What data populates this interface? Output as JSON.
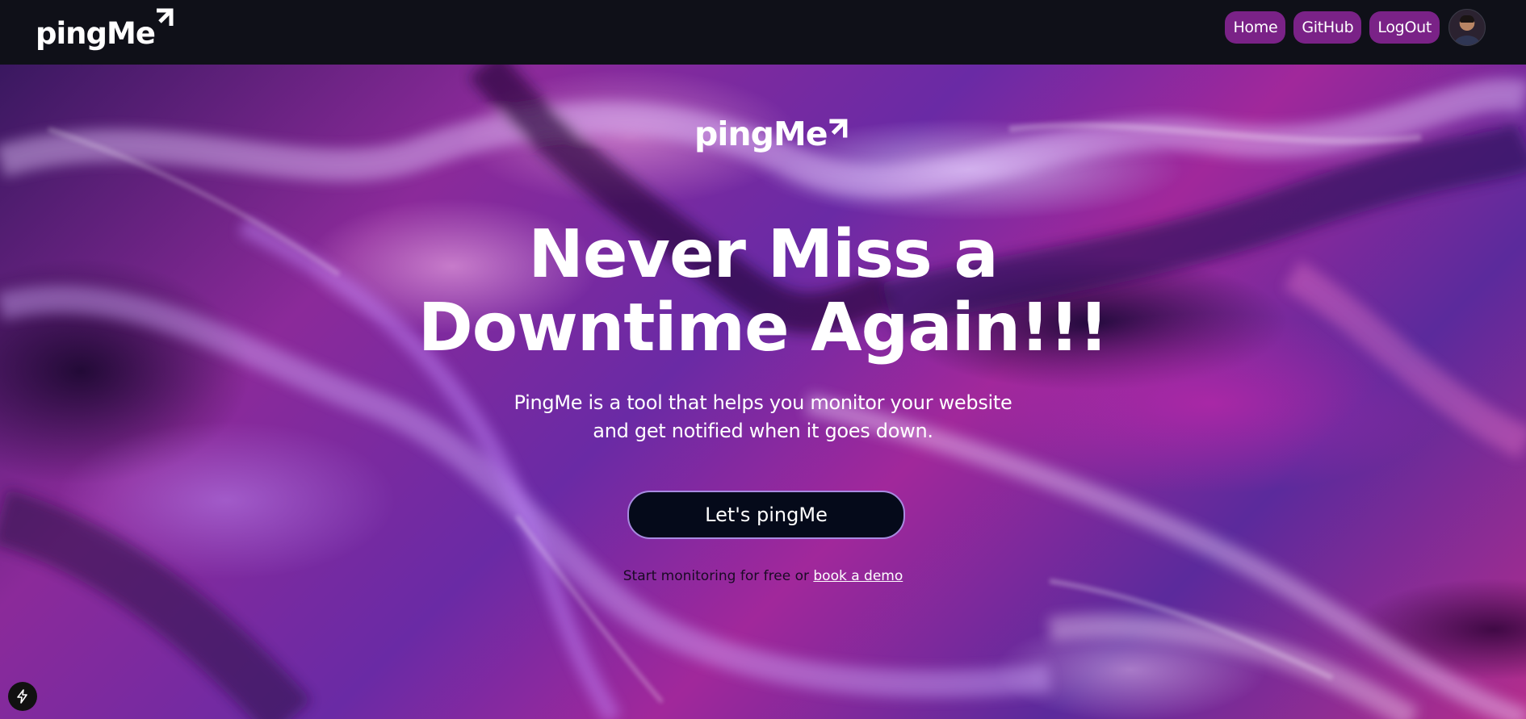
{
  "nav": {
    "logo_text": "pingMe",
    "links": [
      {
        "label": "Home"
      },
      {
        "label": "GitHub"
      },
      {
        "label": "LogOut"
      }
    ],
    "avatar_icon": "user-avatar"
  },
  "hero": {
    "logo_text": "pingMe",
    "headline_line1": "Never Miss a",
    "headline_line2": "Downtime Again!!!",
    "subtext_line1": "PingMe is a tool that helps you monitor your website",
    "subtext_line2": "and get notified when it goes down.",
    "cta_label": "Let's pingMe",
    "footnote_text": "Start monitoring for free or ",
    "footnote_link": "book a demo"
  },
  "colors": {
    "nav_background": "#0f1018",
    "nav_pill": "#7a2287",
    "cta_background": "#050a1a",
    "cta_border": "#a78be0",
    "text": "#ffffff"
  },
  "icons": {
    "logo_corner": "arrow-corner-icon",
    "dev_badge": "lightning-icon"
  }
}
